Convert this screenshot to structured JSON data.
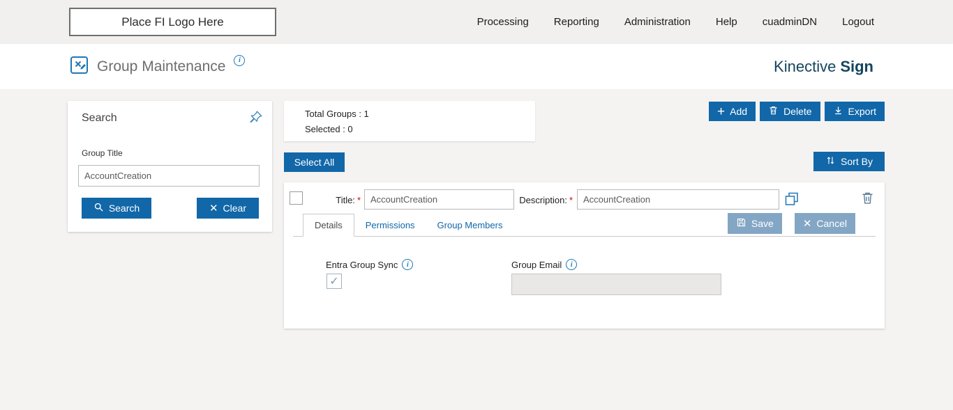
{
  "topbar": {
    "logo_text": "Place FI Logo Here",
    "nav": [
      "Processing",
      "Reporting",
      "Administration",
      "Help",
      "cuadminDN",
      "Logout"
    ]
  },
  "header": {
    "title": "Group Maintenance",
    "brand_name": "Kinective",
    "brand_suffix": "Sign"
  },
  "search_panel": {
    "title": "Search",
    "group_title_label": "Group Title",
    "group_title_value": "AccountCreation",
    "search_button": "Search",
    "clear_button": "Clear"
  },
  "summary": {
    "total_groups_text": "Total Groups : 1",
    "selected_text": "Selected : 0"
  },
  "toolbar": {
    "add_label": "Add",
    "delete_label": "Delete",
    "export_label": "Export",
    "select_all_label": "Select All",
    "sort_by_label": "Sort By"
  },
  "group_row": {
    "title_label": "Title:",
    "required_marker": "*",
    "title_value": "AccountCreation",
    "description_label": "Description:",
    "description_value": "AccountCreation",
    "tabs": [
      "Details",
      "Permissions",
      "Group Members"
    ],
    "save_label": "Save",
    "cancel_label": "Cancel",
    "details_tab": {
      "entra_group_sync_label": "Entra Group Sync",
      "entra_group_sync_checked": true,
      "group_email_label": "Group Email",
      "group_email_value": ""
    }
  },
  "icons": {
    "plus": "+",
    "clear_x": "✕",
    "cancel_x": "✕",
    "check": "✓",
    "info": "i"
  },
  "colors": {
    "primary_blue": "#1167a8",
    "muted_button": "#84a6c5",
    "brand_dark": "#15455e",
    "required_red": "#d40000"
  }
}
